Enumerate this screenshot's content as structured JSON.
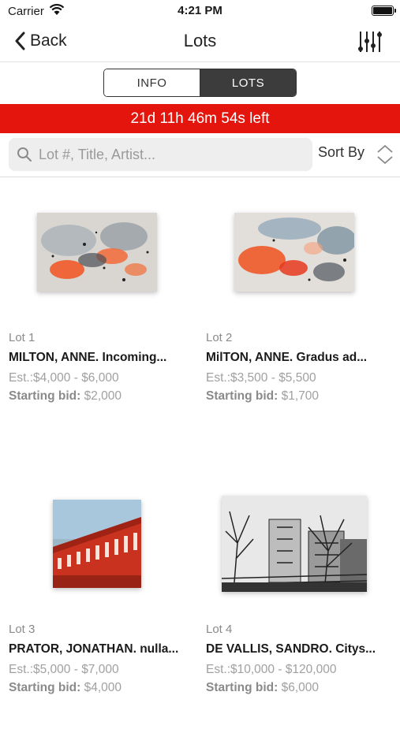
{
  "status_bar": {
    "carrier": "Carrier",
    "time": "4:21 PM"
  },
  "nav": {
    "back_label": "Back",
    "title": "Lots"
  },
  "segment": {
    "info_label": "INFO",
    "lots_label": "LOTS",
    "selected": "LOTS"
  },
  "countdown": {
    "text": "21d 11h 46m 54s left"
  },
  "search": {
    "placeholder": "Lot #, Title, Artist...",
    "sort_label": "Sort By"
  },
  "lots": [
    {
      "lot_label": "Lot 1",
      "title": "MILTON, ANNE. Incoming...",
      "estimate": "Est.:$4,000 - $6,000",
      "starting_bid_label": "Starting bid:",
      "starting_bid_value": "$2,000",
      "image": "abstract-painting-orange-grey"
    },
    {
      "lot_label": "Lot 2",
      "title": "MilTON, ANNE. Gradus ad...",
      "estimate": "Est.:$3,500 - $5,500",
      "starting_bid_label": "Starting bid:",
      "starting_bid_value": "$1,700",
      "image": "abstract-painting-red-blue"
    },
    {
      "lot_label": "Lot 3",
      "title": "PRATOR, JONATHAN. nulla...",
      "estimate": "Est.:$5,000 - $7,000",
      "starting_bid_label": "Starting bid:",
      "starting_bid_value": "$4,000",
      "image": "red-brick-building-painting"
    },
    {
      "lot_label": "Lot 4",
      "title": "DE VALLIS, SANDRO. Citys...",
      "estimate": "Est.:$10,000 - $120,000",
      "starting_bid_label": "Starting bid:",
      "starting_bid_value": "$6,000",
      "image": "black-white-cityscape-drawing"
    }
  ],
  "colors": {
    "countdown_bg": "#e3150d",
    "segment_selected_bg": "#3c3c3c"
  }
}
